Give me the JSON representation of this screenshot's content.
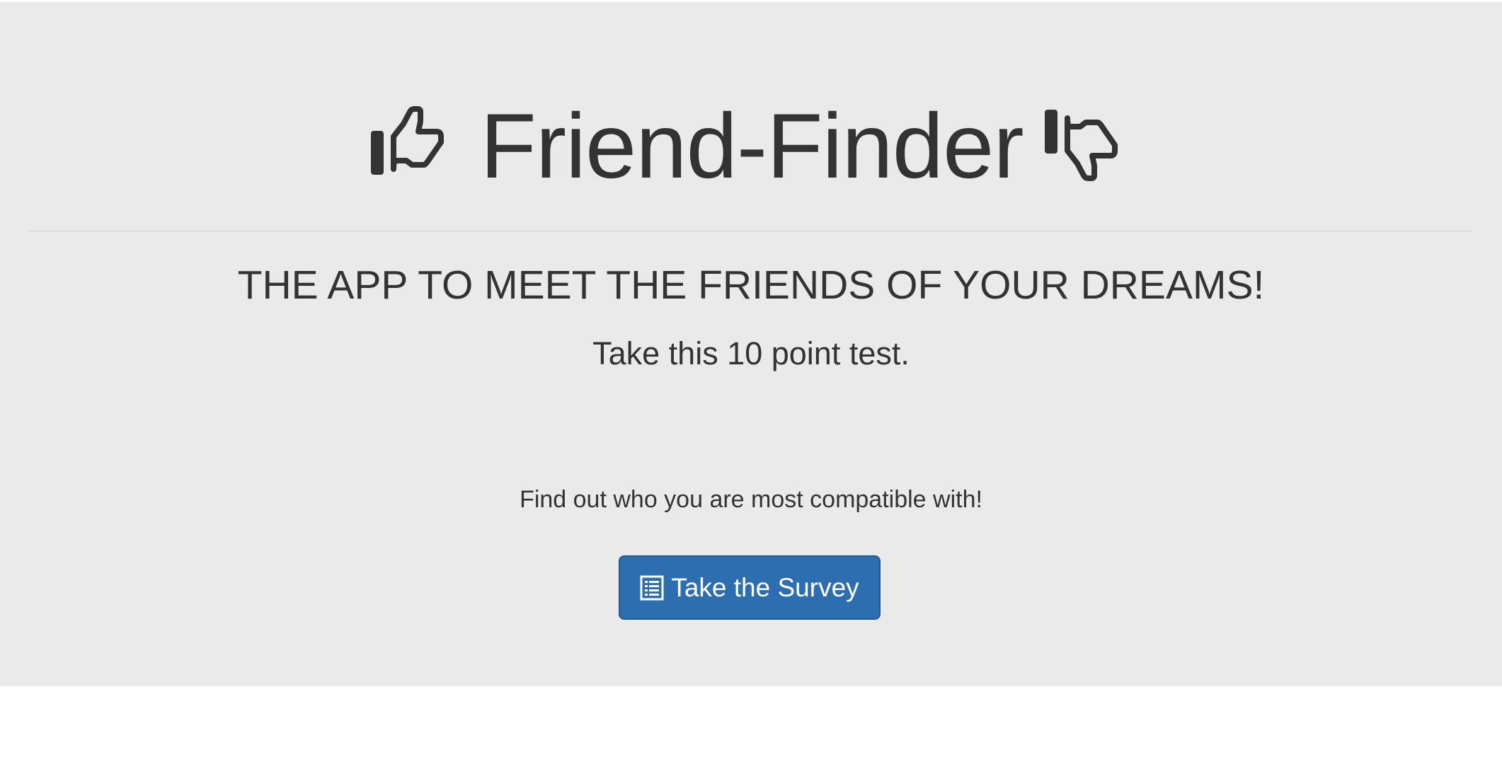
{
  "header": {
    "title": "Friend-Finder",
    "left_icon": "thumbs-up-icon",
    "right_icon": "thumbs-down-icon"
  },
  "tagline": "THE APP TO MEET THE FRIENDS OF YOUR DREAMS!",
  "subtitle": "Take this 10 point test.",
  "prompt": "Find out who you are most compatible with!",
  "survey_button": {
    "label": "Take the Survey",
    "icon": "list-alt-icon"
  },
  "colors": {
    "jumbotron_bg": "#eaeaea",
    "text": "#333333",
    "button_bg": "#2c6eb0",
    "button_text": "#ffffff"
  }
}
